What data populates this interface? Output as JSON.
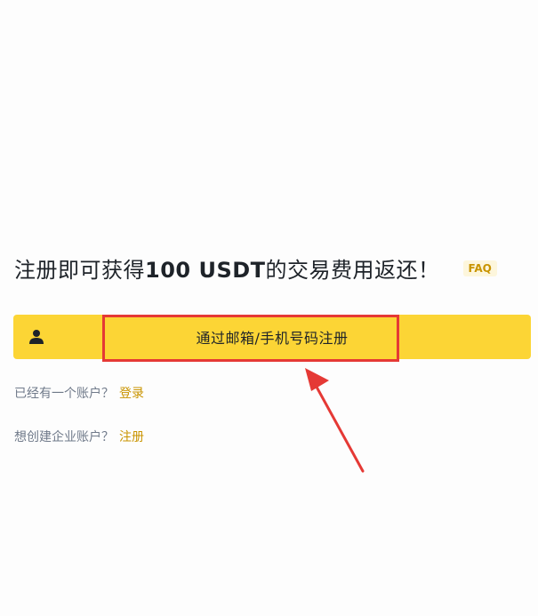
{
  "headline": {
    "prefix": "注册即可获得",
    "highlight": "100 USDT",
    "suffix": "的交易费用返还！"
  },
  "faq_label": "FAQ",
  "register_button": {
    "label": "通过邮箱/手机号码注册",
    "icon": "user-icon"
  },
  "login_line": {
    "text": "已经有一个账户？",
    "link": "登录"
  },
  "enterprise_line": {
    "text": "想创建企业账户？",
    "link": "注册"
  },
  "colors": {
    "accent": "#fcd535",
    "link": "#c99400",
    "annotation": "#e53935"
  }
}
